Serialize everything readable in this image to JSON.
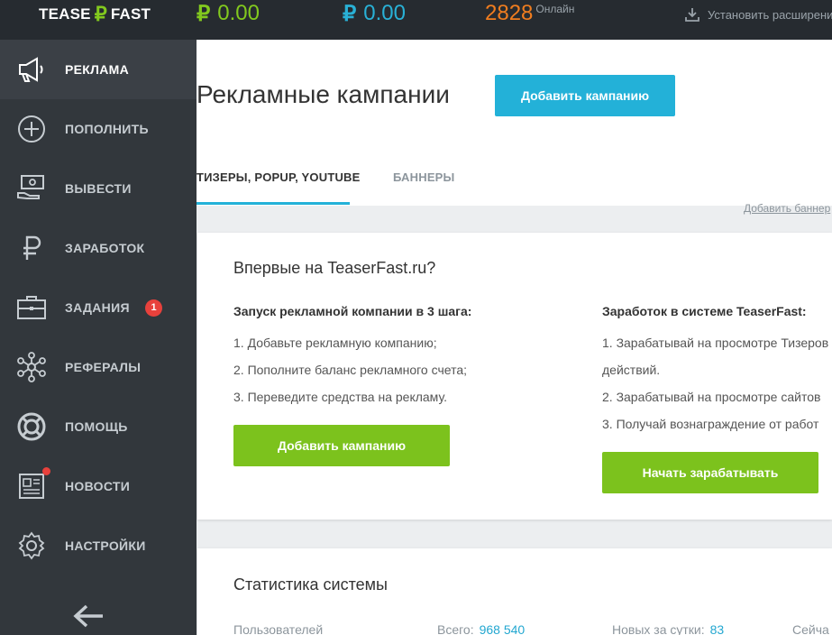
{
  "topbar": {
    "logo_left": "TEASE",
    "logo_symbol": "₽",
    "logo_right": "FAST",
    "balance1": {
      "symbol": "₽",
      "value": "0.00",
      "color": "#82c91e"
    },
    "balance2": {
      "symbol": "₽",
      "value": "0.00",
      "color": "#29b1d6"
    },
    "online_count": "2828",
    "online_label": "Онлайн",
    "extension_label": "Установить расширение"
  },
  "sidebar": {
    "items": [
      {
        "label": "РЕКЛАМА",
        "icon": "megaphone-icon",
        "active": true
      },
      {
        "label": "ПОПОЛНИТЬ",
        "icon": "plus-circle-icon"
      },
      {
        "label": "ВЫВЕСТИ",
        "icon": "cash-withdraw-icon"
      },
      {
        "label": "ЗАРАБОТОК",
        "icon": "ruble-icon"
      },
      {
        "label": "ЗАДАНИЯ",
        "icon": "briefcase-icon",
        "badge": "1"
      },
      {
        "label": "РЕФЕРАЛЫ",
        "icon": "network-icon"
      },
      {
        "label": "ПОМОЩЬ",
        "icon": "lifebuoy-icon"
      },
      {
        "label": "НОВОСТИ",
        "icon": "newspaper-icon",
        "dot": true
      },
      {
        "label": "НАСТРОЙКИ",
        "icon": "gear-icon"
      }
    ],
    "collapse_icon": "arrow-left-icon"
  },
  "main": {
    "title": "Рекламные кампании",
    "add_campaign_button": "Добавить кампанию",
    "tabs": [
      {
        "label": "ТИЗЕРЫ, POPUP, YOUTUBE",
        "active": true
      },
      {
        "label": "БАННЕРЫ",
        "active": false
      }
    ],
    "add_banner_link": "Добавить баннер",
    "intro": {
      "title": "Впервые на TeaserFast.ru?",
      "left": {
        "heading": "Запуск рекламной компании в 3 шага:",
        "lines": [
          "1. Добавьте рекламную компанию;",
          "2. Пополните баланс рекламного счета;",
          "3. Переведите средства на рекламу."
        ],
        "button": "Добавить кампанию"
      },
      "right": {
        "heading": "Заработок в системе TeaserFast:",
        "lines": [
          "1. Зарабатывай на просмотре Тизеров",
          "действий.",
          "2. Зарабатывай на просмотре сайтов",
          "3. Получай вознаграждение от работ"
        ],
        "button": "Начать зарабатывать"
      }
    },
    "stats": {
      "title": "Статистика системы",
      "row_label": "Пользователей",
      "total_label": "Всего:",
      "total_value": "968 540",
      "new_label": "Новых за сутки:",
      "new_value": "83",
      "now_label": "Сейча"
    }
  },
  "colors": {
    "accent_blue": "#23b1d8",
    "accent_green": "#7cc21d",
    "badge_red": "#e8413c",
    "sidebar_bg": "#32373c",
    "topbar_bg": "#262b30"
  }
}
